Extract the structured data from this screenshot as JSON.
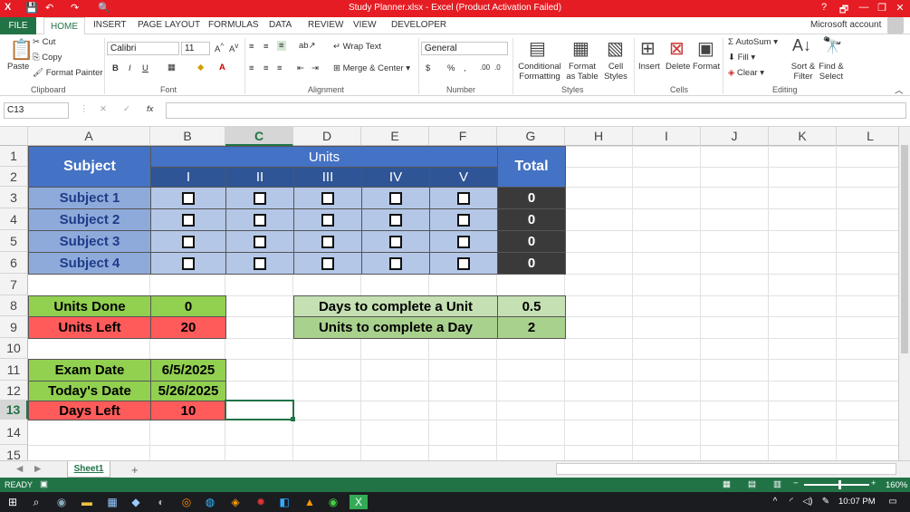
{
  "window": {
    "title": "Study Planner.xlsx -  Excel (Product Activation Failed)",
    "help": "?",
    "min": "—",
    "restore": "❐",
    "close": "✕",
    "ribbon_toggle": "🗗"
  },
  "tabs": {
    "file": "FILE",
    "home": "HOME",
    "insert": "INSERT",
    "page_layout": "PAGE LAYOUT",
    "formulas": "FORMULAS",
    "data": "DATA",
    "review": "REVIEW",
    "view": "VIEW",
    "developer": "DEVELOPER",
    "account": "Microsoft account"
  },
  "ribbon": {
    "clipboard": {
      "paste": "Paste",
      "cut": "Cut",
      "copy": "Copy",
      "format_painter": "Format Painter",
      "label": "Clipboard"
    },
    "font": {
      "name": "Calibri",
      "size": "11",
      "bold": "B",
      "italic": "I",
      "underline": "U",
      "label": "Font"
    },
    "alignment": {
      "wrap": "Wrap Text",
      "merge": "Merge & Center",
      "label": "Alignment"
    },
    "number": {
      "format": "General",
      "currency": "$",
      "percent": "%",
      "comma": ",",
      "label": "Number"
    },
    "styles": {
      "cond": "Conditional Formatting",
      "table": "Format as Table",
      "cell": "Cell Styles",
      "label": "Styles"
    },
    "cells": {
      "insert": "Insert",
      "delete": "Delete",
      "format": "Format",
      "label": "Cells"
    },
    "editing": {
      "autosum": "AutoSum",
      "fill": "Fill",
      "clear": "Clear",
      "sort": "Sort & Filter",
      "find": "Find & Select",
      "label": "Editing"
    }
  },
  "formula_bar": {
    "name_box": "C13",
    "fx": "fx",
    "value": ""
  },
  "columns": [
    "A",
    "B",
    "C",
    "D",
    "E",
    "F",
    "G",
    "H",
    "I",
    "J",
    "K",
    "L"
  ],
  "rows": [
    "1",
    "2",
    "3",
    "4",
    "5",
    "6",
    "7",
    "8",
    "9",
    "10",
    "11",
    "12",
    "13",
    "14",
    "15"
  ],
  "sheet": {
    "subject_header": "Subject",
    "units_header": "Units",
    "total_header": "Total",
    "unit_labels": [
      "I",
      "II",
      "III",
      "IV",
      "V"
    ],
    "subjects": [
      {
        "name": "Subject 1",
        "total": "0"
      },
      {
        "name": "Subject 2",
        "total": "0"
      },
      {
        "name": "Subject 3",
        "total": "0"
      },
      {
        "name": "Subject 4",
        "total": "0"
      }
    ],
    "units_done_label": "Units Done",
    "units_done_value": "0",
    "units_left_label": "Units Left",
    "units_left_value": "20",
    "days_unit_label": "Days to complete a Unit",
    "days_unit_value": "0.5",
    "units_day_label": "Units to complete a Day",
    "units_day_value": "2",
    "exam_label": "Exam Date",
    "exam_value": "6/5/2025",
    "today_label": "Today's Date",
    "today_value": "5/26/2025",
    "days_left_label": "Days Left",
    "days_left_value": "10"
  },
  "sheet_tabs": {
    "active": "Sheet1",
    "add": "+"
  },
  "status": {
    "ready": "READY",
    "zoom": "160%"
  },
  "taskbar": {
    "time": "10:07 PM"
  },
  "colors": {
    "blue": "#4472c4",
    "dark_blue": "#2f5597",
    "light_blue": "#b4c7e7",
    "subject_blue": "#8eaadb",
    "total_dark": "#3a3a3a",
    "green": "#92d050",
    "red": "#ff5b5b",
    "light_green": "#c5e0b3",
    "mid_green": "#a9d18e",
    "excel_green": "#217346"
  }
}
